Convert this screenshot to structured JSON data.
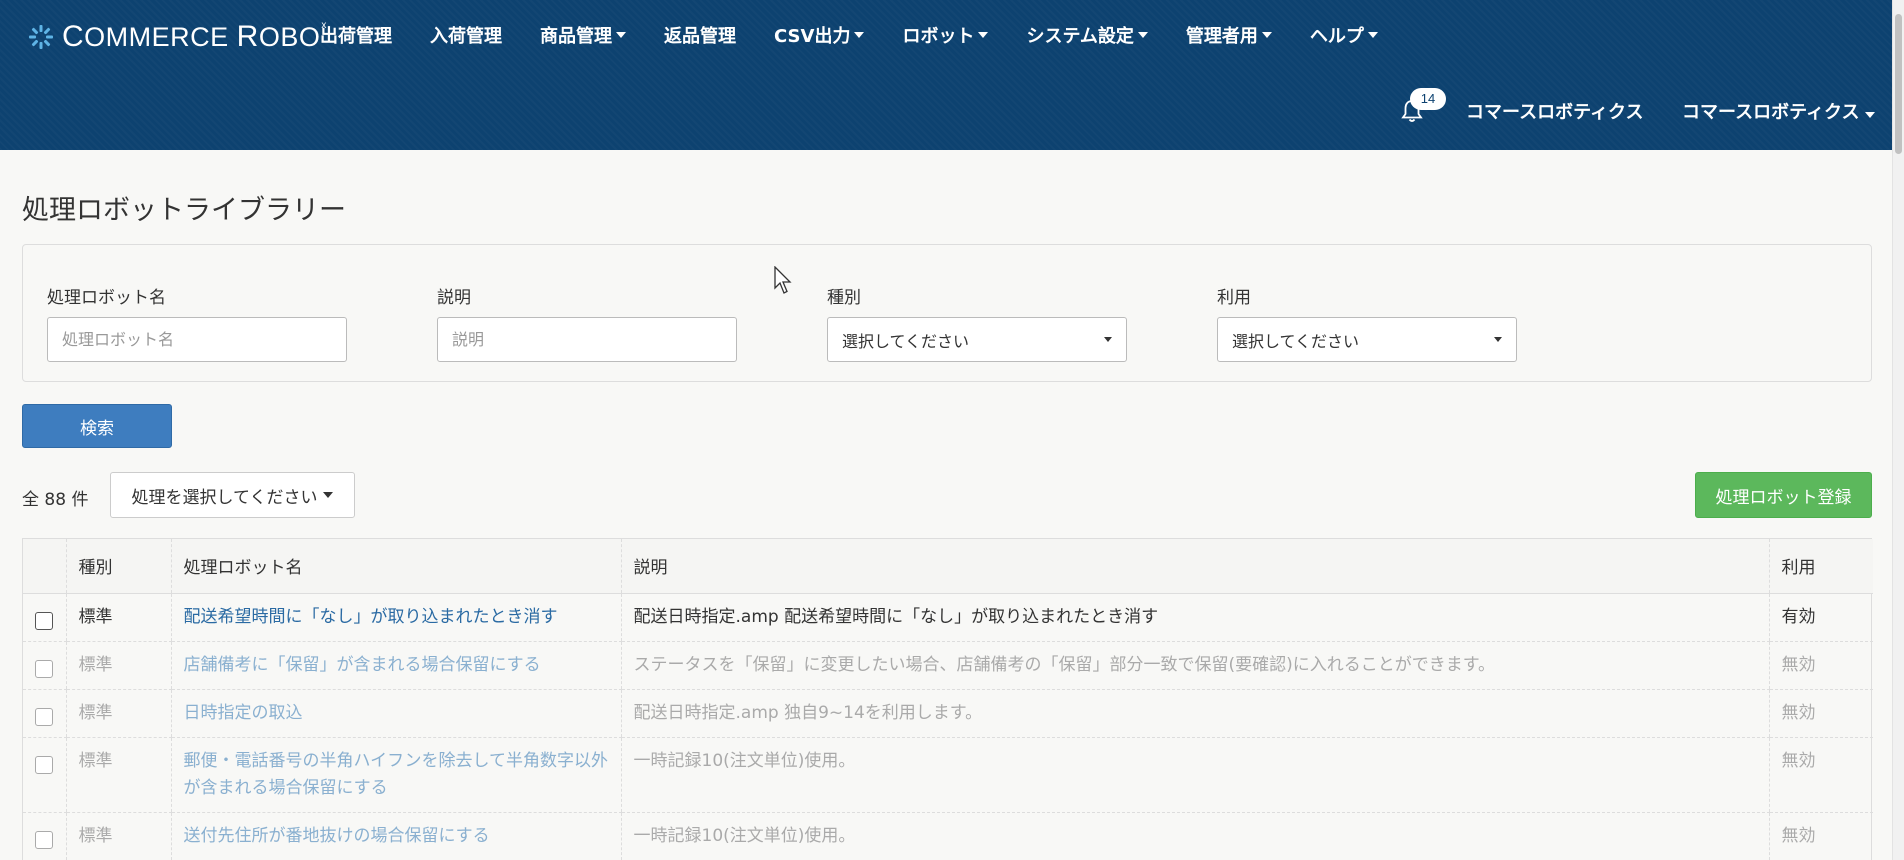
{
  "app": {
    "logo_c": "C",
    "logo_ommerce": "OMMERCE ",
    "logo_r": "R",
    "logo_obo": "OBO",
    "logo_x": "x"
  },
  "nav": [
    {
      "label": "出荷管理",
      "dropdown": false
    },
    {
      "label": "入荷管理",
      "dropdown": false
    },
    {
      "label": "商品管理",
      "dropdown": true
    },
    {
      "label": "返品管理",
      "dropdown": false
    },
    {
      "label": "CSV出力",
      "dropdown": true
    },
    {
      "label": "ロボット",
      "dropdown": true
    },
    {
      "label": "システム設定",
      "dropdown": true
    },
    {
      "label": "管理者用",
      "dropdown": true
    },
    {
      "label": "ヘルプ",
      "dropdown": true
    }
  ],
  "header_right": {
    "notification_count": "14",
    "company_name": "コマースロボティクス",
    "user_menu": "コマースロボティクス"
  },
  "page": {
    "title": "処理ロボットライブラリー"
  },
  "search": {
    "name_label": "処理ロボット名",
    "name_placeholder": "処理ロボット名",
    "desc_label": "説明",
    "desc_placeholder": "説明",
    "type_label": "種別",
    "type_value": "選択してください",
    "use_label": "利用",
    "use_value": "選択してください",
    "button": "検索"
  },
  "toolbar": {
    "count": "全 88 件",
    "action_select": "処理を選択してください",
    "register_button": "処理ロボット登録"
  },
  "table": {
    "headers": [
      "種別",
      "処理ロボット名",
      "説明",
      "利用"
    ],
    "rows": [
      {
        "type": "標準",
        "name": "配送希望時間に「なし」が取り込まれたとき消す",
        "desc": "配送日時指定.amp 配送希望時間に「なし」が取り込まれたとき消す",
        "use": "有効",
        "active": true
      },
      {
        "type": "標準",
        "name": "店舗備考に「保留」が含まれる場合保留にする",
        "desc": "ステータスを「保留」に変更したい場合、店舗備考の「保留」部分一致で保留(要確認)に入れることができます。",
        "use": "無効",
        "active": false
      },
      {
        "type": "標準",
        "name": "日時指定の取込",
        "desc": "配送日時指定.amp 独自9~14を利用します。",
        "use": "無効",
        "active": false
      },
      {
        "type": "標準",
        "name": "郵便・電話番号の半角ハイフンを除去して半角数字以外が含まれる場合保留にする",
        "desc": "一時記録10(注文単位)使用。",
        "use": "無効",
        "active": false
      },
      {
        "type": "標準",
        "name": "送付先住所が番地抜けの場合保留にする",
        "desc": "一時記録10(注文単位)使用。",
        "use": "無効",
        "active": false
      }
    ]
  },
  "colors": {
    "header_bg": "#0d4270",
    "primary": "#3e7dbf",
    "success": "#5cb85c",
    "link": "#2a6aa3"
  }
}
